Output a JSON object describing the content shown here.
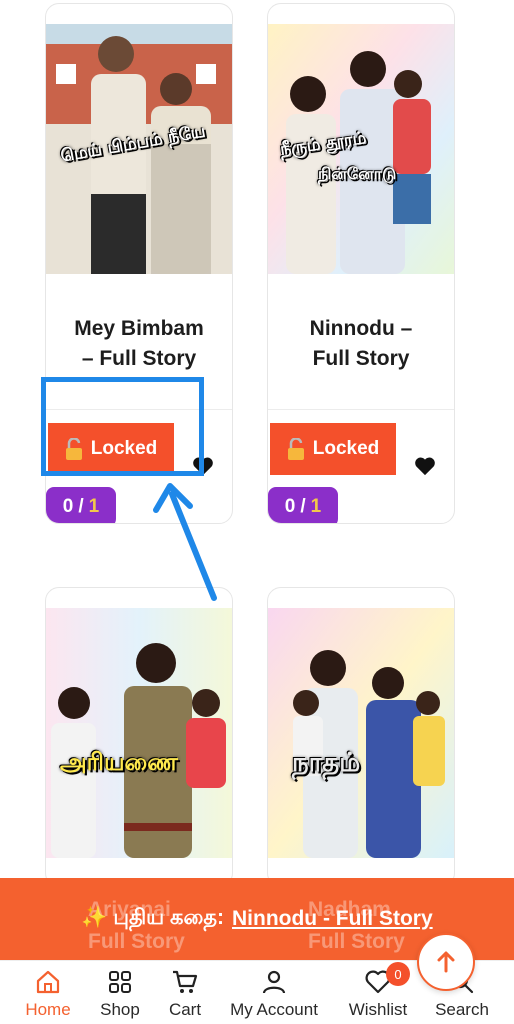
{
  "products": [
    {
      "cover_title": "மெய் பிம்பம் நீயே",
      "title_line1": "Mey Bimbam",
      "title_line2": "– Full Story",
      "button_label": "Locked",
      "count": "0",
      "count_sep": "/",
      "count_total": "1"
    },
    {
      "cover_title_line1": "நீரும் தூரம்",
      "cover_title_line2": "நின்னோடு",
      "title_line1": "Ninnodu –",
      "title_line2": "Full Story",
      "button_label": "Locked",
      "count": "0",
      "count_sep": "/",
      "count_total": "1"
    },
    {
      "cover_title": "அரியணை"
    },
    {
      "cover_title": "நாதம்"
    }
  ],
  "banner": {
    "prefix": "✨ புதிய கதை:",
    "link": "Ninnodu - Full Story",
    "ghost_left": "Ariyanai",
    "ghost_left2": "Full Story",
    "ghost_right": "Nadham",
    "ghost_right2": "Full Story"
  },
  "nav": {
    "home": "Home",
    "shop": "Shop",
    "cart": "Cart",
    "account": "My Account",
    "wishlist": "Wishlist",
    "search": "Search",
    "wishlist_count": "0"
  },
  "colors": {
    "accent": "#f4612f",
    "locked": "#f4502b",
    "badge": "#8b2fc9",
    "highlight": "#1f88e8"
  },
  "icons": [
    "home-icon",
    "grid-icon",
    "cart-icon",
    "user-icon",
    "heart-icon",
    "search-icon",
    "lock-icon",
    "arrow-up-icon"
  ]
}
